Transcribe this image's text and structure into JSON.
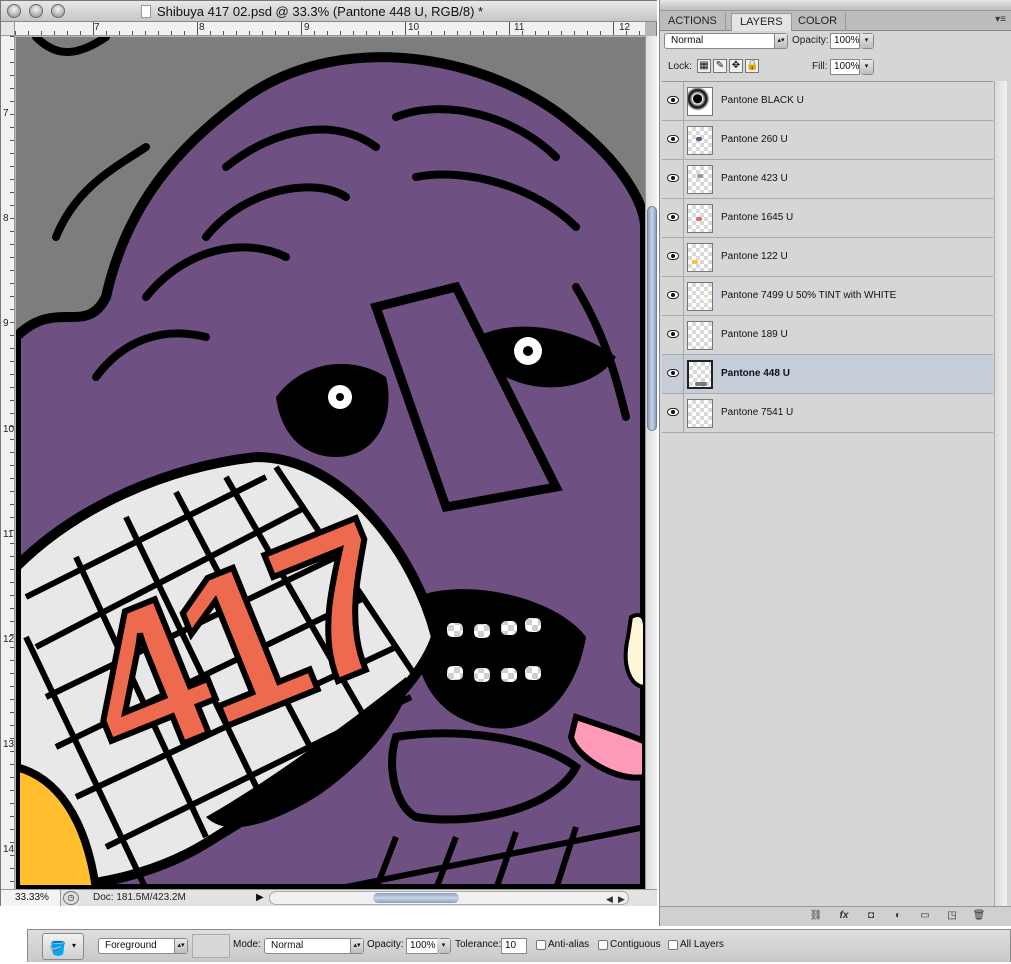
{
  "document": {
    "title": "Shibuya 417 02.psd @ 33.3% (Pantone 448 U, RGB/8) *",
    "ruler_top": [
      "7",
      "8",
      "9",
      "10",
      "11",
      "12"
    ],
    "ruler_left": [
      "7",
      "8",
      "9",
      "10",
      "11",
      "12",
      "13",
      "14"
    ],
    "artwork_text": "417",
    "zoom": "33.33%",
    "doc_size": "Doc: 181.5M/423.2M"
  },
  "panel": {
    "tabs": [
      "ACTIONS",
      "LAYERS",
      "COLOR"
    ],
    "active_tab": "LAYERS",
    "blend_mode": "Normal",
    "opacity_label": "Opacity:",
    "opacity": "100%",
    "lock_label": "Lock:",
    "fill_label": "Fill:",
    "fill": "100%",
    "layers": [
      {
        "name": "Pantone BLACK U",
        "visible": true,
        "selected": false
      },
      {
        "name": "Pantone 260 U",
        "visible": true,
        "selected": false
      },
      {
        "name": "Pantone 423 U",
        "visible": true,
        "selected": false
      },
      {
        "name": "Pantone 1645 U",
        "visible": true,
        "selected": false
      },
      {
        "name": "Pantone 122 U",
        "visible": true,
        "selected": false
      },
      {
        "name": "Pantone 7499 U 50% TINT with WHITE",
        "visible": true,
        "selected": false
      },
      {
        "name": "Pantone 189 U",
        "visible": true,
        "selected": false
      },
      {
        "name": "Pantone 448 U",
        "visible": true,
        "selected": true
      },
      {
        "name": "Pantone 7541 U",
        "visible": true,
        "selected": false
      }
    ],
    "footer_icons": [
      "link-icon",
      "fx-icon",
      "mask-icon",
      "adjustment-icon",
      "group-icon",
      "new-layer-icon",
      "trash-icon"
    ]
  },
  "options_bar": {
    "tool_icon": "paint-bucket-icon",
    "source": "Foreground",
    "mode_label": "Mode:",
    "mode": "Normal",
    "opacity_label": "Opacity:",
    "opacity": "100%",
    "tolerance_label": "Tolerance:",
    "tolerance": "10",
    "anti_alias": "Anti-alias",
    "contiguous": "Contiguous",
    "all_layers": "All Layers"
  },
  "colors": {
    "purple": "#6e5082",
    "outline": "#000000",
    "grey_bg": "#7d7d7d",
    "mask_white": "#e8e8e8",
    "number_red": "#ee6a4f",
    "yellow": "#ffbf2f",
    "tongue_pink": "#ff9ab8",
    "selected_row": "#c5cdd9"
  }
}
